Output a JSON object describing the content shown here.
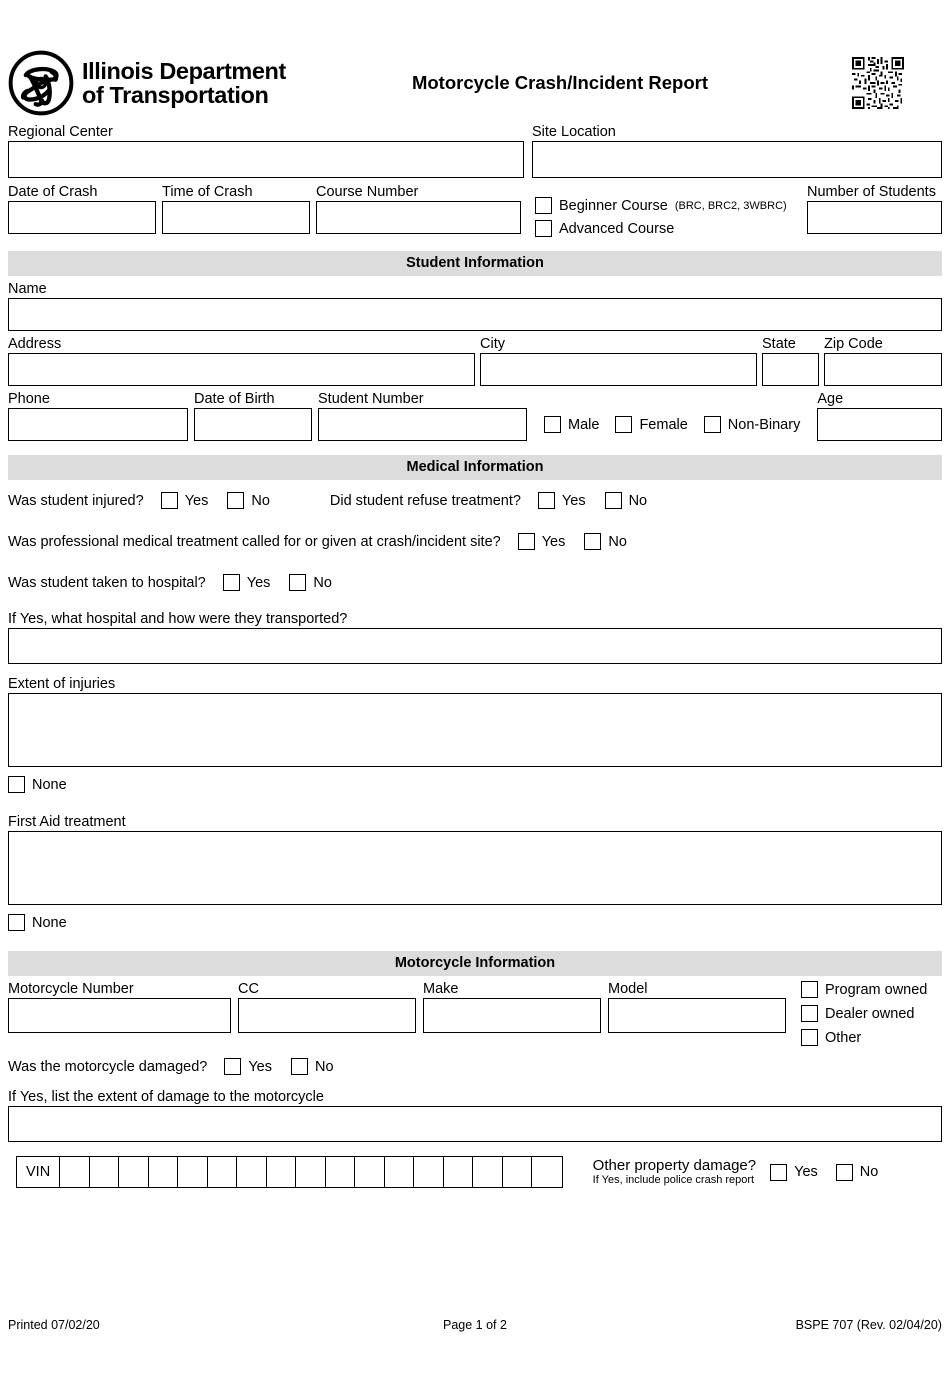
{
  "document": {
    "title": "Motorcycle Crash/Incident Report",
    "agency_line1": "Illinois Department",
    "agency_line2": "of Transportation",
    "logo_icon": "idot-trefoil-logo",
    "qr_icon": "qr-code"
  },
  "header_fields": {
    "regional_center_label": "Regional Center",
    "site_location_label": "Site Location",
    "date_of_crash_label": "Date of Crash",
    "time_of_crash_label": "Time of Crash",
    "course_number_label": "Course Number",
    "beginner_course_label": "Beginner Course",
    "beginner_course_note": "(BRC, BRC2, 3WBRC)",
    "advanced_course_label": "Advanced Course",
    "number_of_students_label": "Number of Students",
    "regional_center_value": "",
    "site_location_value": "",
    "date_of_crash_value": "",
    "time_of_crash_value": "",
    "course_number_value": "",
    "number_of_students_value": ""
  },
  "student_section": {
    "heading": "Student Information",
    "name_label": "Name",
    "name_value": "",
    "address_label": "Address",
    "address_value": "",
    "city_label": "City",
    "city_value": "",
    "state_label": "State",
    "state_value": "",
    "zip_label": "Zip Code",
    "zip_value": "",
    "phone_label": "Phone",
    "phone_value": "",
    "dob_label": "Date of Birth",
    "dob_value": "",
    "student_number_label": "Student Number",
    "student_number_value": "",
    "gender_options": [
      "Male",
      "Female",
      "Non-Binary"
    ],
    "age_label": "Age",
    "age_value": ""
  },
  "medical_section": {
    "heading": "Medical Information",
    "q1": "Was student injured?",
    "q2": "Did student refuse treatment?",
    "q3": "Was professional medical treatment called for or given at crash/incident site?",
    "q4": "Was student taken to hospital?",
    "yes": "Yes",
    "no": "No",
    "hospital_label": "If Yes, what hospital and how were they transported?",
    "hospital_value": "",
    "injuries_label": "Extent of injuries",
    "injuries_value": "",
    "injuries_none_label": "None",
    "first_aid_label": "First Aid treatment",
    "first_aid_value": "",
    "first_aid_none_label": "None"
  },
  "motorcycle_section": {
    "heading": "Motorcycle Information",
    "motorcycle_number_label": "Motorcycle Number",
    "motorcycle_number_value": "",
    "cc_label": "CC",
    "cc_value": "",
    "make_label": "Make",
    "make_value": "",
    "model_label": "Model",
    "model_value": "",
    "ownership_options": [
      "Program owned",
      "Dealer owned",
      "Other"
    ],
    "damaged_question": "Was the motorcycle damaged?",
    "yes": "Yes",
    "no": "No",
    "damage_extent_label": "If Yes, list the extent of damage to the motorcycle",
    "damage_extent_value": "",
    "vin_label": "VIN",
    "vin_cells": 17,
    "other_damage_question": "Other property damage?",
    "other_damage_note": "If Yes, include police crash report"
  },
  "footer": {
    "printed": "Printed 07/02/20",
    "page": "Page 1 of 2",
    "form_id": "BSPE 707 (Rev. 02/04/20)"
  },
  "colors": {
    "section_header_bg": "#dcdcdc",
    "border": "#000000",
    "page_bg": "#ffffff"
  }
}
